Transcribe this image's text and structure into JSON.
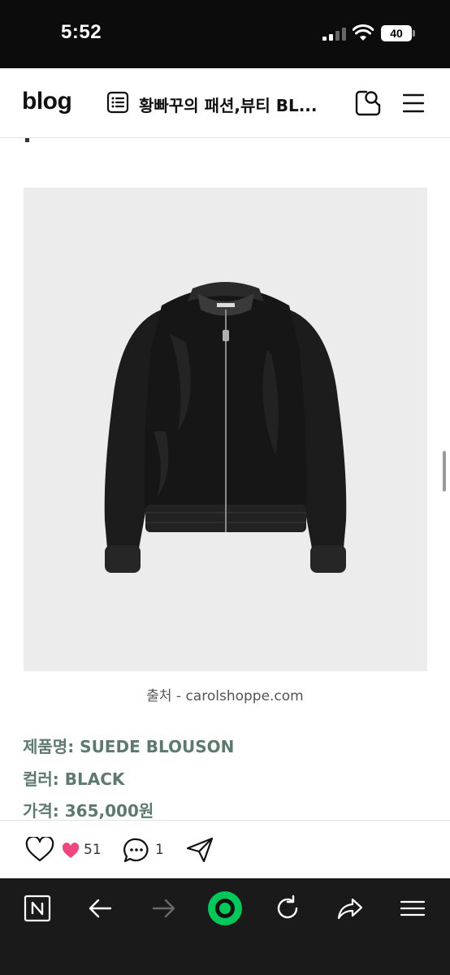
{
  "status_bar": {
    "time": "5:52",
    "battery": "40"
  },
  "header": {
    "logo": "blog",
    "blog_title": "황빠꾸의 패션,뷰티 BL...",
    "icons": [
      "list-icon",
      "search-icon",
      "menu-icon"
    ]
  },
  "image": {
    "caption": "출처 - carolshoppe.com"
  },
  "product": {
    "name": "제품명: SUEDE BLOUSON",
    "color": "컬러: BLACK",
    "price": "가격: 365,000원"
  },
  "actions": {
    "like_count": "51",
    "comment_count": "1"
  },
  "colors": {
    "info_text": "#5e7a6f",
    "heart": "#f0477e",
    "naver_green": "#03c75a"
  }
}
